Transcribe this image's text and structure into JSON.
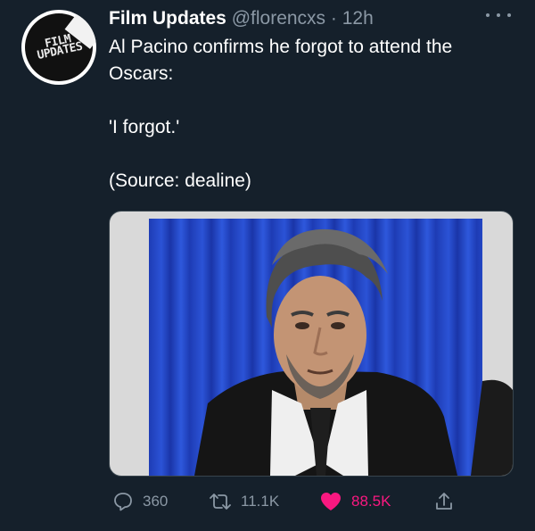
{
  "account": {
    "display_name": "Film Updates",
    "handle": "@florencxs",
    "separator": "·",
    "timestamp": "12h",
    "avatar_text_line1": "FILM",
    "avatar_text_line2": "UPDATES"
  },
  "tweet": {
    "line1": "Al Pacino confirms he forgot to attend the",
    "line2": "Oscars:",
    "quote": "'I forgot.'",
    "source": "(Source: dealine)"
  },
  "stats": {
    "replies": "360",
    "retweets": "11.1K",
    "likes": "88.5K"
  },
  "icons": {
    "more": "more-horizontal-icon",
    "reply": "reply-icon",
    "retweet": "retweet-icon",
    "like": "heart-icon",
    "share": "share-icon"
  },
  "colors": {
    "background": "#15202b",
    "secondary_text": "#8b98a5",
    "like": "#f91880",
    "curtain": "#2b53d6"
  }
}
